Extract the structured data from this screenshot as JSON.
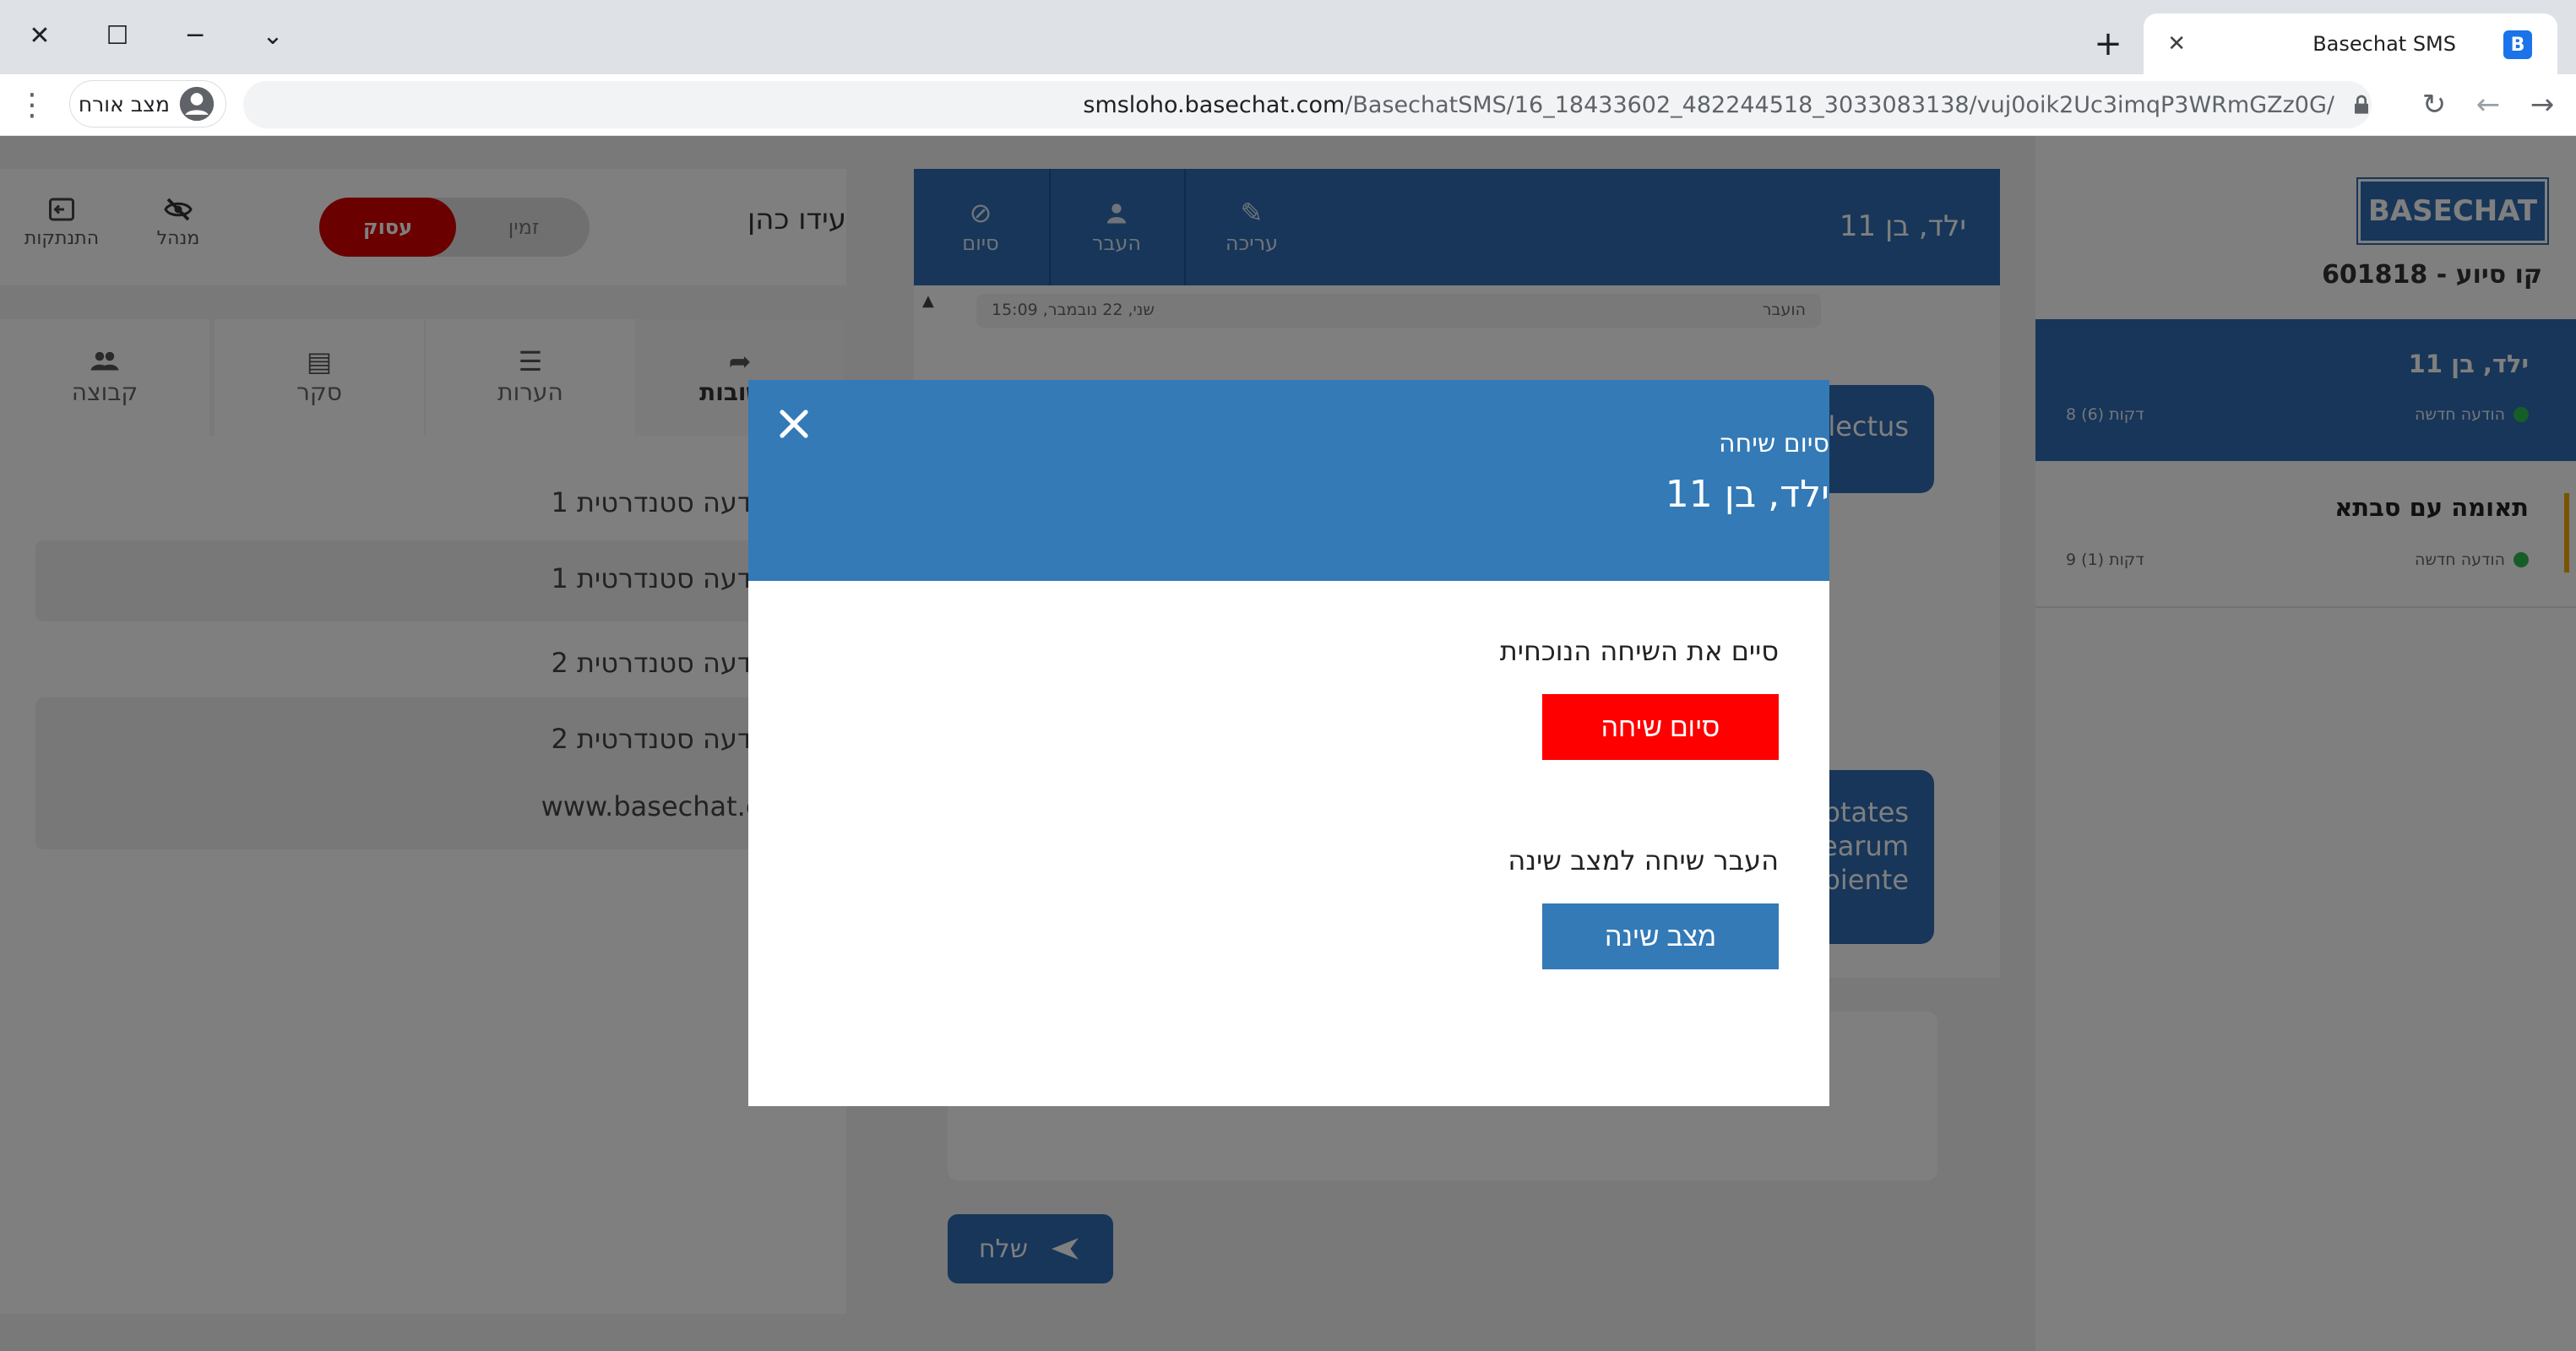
{
  "browser": {
    "tab_title": "Basechat SMS",
    "favicon_letter": "B",
    "url_host": "smsloho.basechat.com",
    "url_path": "/BasechatSMS/16_18433602_482244518_3033083138/vuj0oik2Uc3imqP3WRmGZz0G/",
    "profile_label": "מצב אורח"
  },
  "agent": {
    "name": "עידו כהן",
    "status_busy": "עסוק",
    "status_available": "זמין",
    "manager_label": "מנהל",
    "logout_label": "התנתקות"
  },
  "left_tabs": [
    {
      "label": "תשובות",
      "icon": "share-icon"
    },
    {
      "label": "הערות",
      "icon": "notes-icon"
    },
    {
      "label": "סקר",
      "icon": "survey-icon"
    },
    {
      "label": "קבוצה",
      "icon": "group-icon"
    }
  ],
  "standard_messages": {
    "m1_title": "הודעה סטנדרטית 1",
    "m1_body": "הודעה סטנדרטית 1",
    "m2_title": "הודעה סטנדרטית 2",
    "m2_body": "הודעה סטנדרטית 2",
    "m2_link": "www.basechat.co"
  },
  "conversation": {
    "title": "ילד, בן 11",
    "edit_label": "עריכה",
    "transfer_label": "העבר",
    "end_label": "סיום",
    "system_msg_left": "שני, 22 נובמבר, 15:09",
    "system_msg_right": "הועבר",
    "bubble1_text": "lectus",
    "bubble2_line1": "ptates",
    "bubble2_line2": "earum",
    "bubble2_line3": "piente",
    "send_label": "שלח"
  },
  "sidebar": {
    "logo": "BASECHAT",
    "support_line": "קו סיוע - 601818",
    "items": [
      {
        "name": "ילד, בן 11",
        "status": "הודעה חדשה",
        "time": "8 דקות (6)"
      },
      {
        "name": "תאומה עם סבתא",
        "status": "הודעה חדשה",
        "time": "9 דקות (1)"
      }
    ]
  },
  "modal": {
    "subtitle": "סיום שיחה",
    "title": "ילד, בן 11",
    "end_prompt": "סיים את השיחה הנוכחית",
    "end_button": "סיום שיחה",
    "sleep_prompt": "העבר שיחה למצב שינה",
    "sleep_button": "מצב שינה"
  },
  "colors": {
    "primary": "#337ab7",
    "header_blue": "#2f6cb2",
    "danger": "#ff0000",
    "busy": "#d60000",
    "online": "#2dbb4f"
  }
}
